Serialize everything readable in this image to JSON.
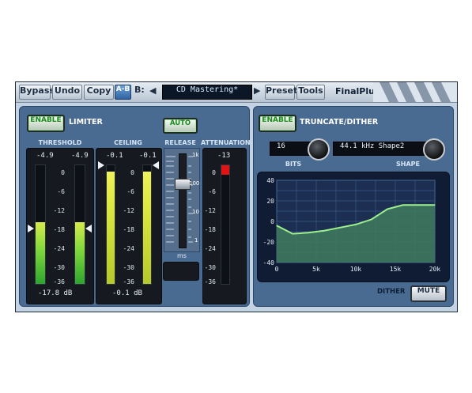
{
  "toolbar": {
    "bypass": "Bypass",
    "undo": "Undo",
    "copy": "Copy",
    "ab": "A-B",
    "b_label": "B:",
    "prev_arrow": "◀",
    "next_arrow": "▶",
    "preset_name": "CD Mastering*",
    "preset": "Preset",
    "tools": "Tools",
    "brand": "FinalPlug"
  },
  "limiter": {
    "enable_label": "ENABLE",
    "title": "LIMITER",
    "threshold": {
      "label": "THRESHOLD",
      "left_peak": "-4.9",
      "right_peak": "-4.9",
      "value": "-17.8 dB",
      "left_level": 0.52,
      "right_level": 0.52
    },
    "ceiling": {
      "label": "CEILING",
      "left_peak": "-0.1",
      "right_peak": "-0.1",
      "value": "-0.1 dB",
      "left_level": 0.95,
      "right_level": 0.95
    },
    "scale": [
      "0",
      "-6",
      "-12",
      "-18",
      "-24",
      "-30",
      "-36"
    ],
    "release": {
      "label": "RELEASE",
      "auto_label": "AUTO",
      "scale": [
        "1k",
        "100",
        "10",
        "1"
      ],
      "unit": "ms",
      "position": 0.3
    },
    "attenuation": {
      "label": "ATTENUATION",
      "peak": "-13",
      "scale": [
        "0",
        "-6",
        "-12",
        "-18",
        "-24",
        "-30",
        "-36"
      ],
      "level": 0.08
    }
  },
  "truncate": {
    "enable_label": "ENABLE",
    "title": "TRUNCATE/DITHER",
    "bits_value": "16",
    "bits_label": "BITS",
    "shape_value": "44.1 kHz Shape2",
    "shape_label": "SHAPE",
    "dither_label": "DITHER",
    "mute_label": "MUTE"
  },
  "chart_data": {
    "type": "area",
    "x": [
      0,
      2000,
      4000,
      6000,
      8000,
      10000,
      12000,
      14000,
      16000,
      18000,
      20000
    ],
    "y": [
      -4,
      -12,
      -11,
      -9,
      -6,
      -3,
      2,
      12,
      16,
      16,
      16
    ],
    "xlim": [
      0,
      20000
    ],
    "ylim": [
      -40,
      40
    ],
    "xticks": [
      "0",
      "5k",
      "10k",
      "15k",
      "20k"
    ],
    "yticks": [
      "40",
      "20",
      "0",
      "-20",
      "-40"
    ],
    "grid": true,
    "line_color": "#9ef08d",
    "fill_color": "#3f7a5e"
  },
  "colors": {
    "panel": "#496b92",
    "meter_green": "#2ea52e",
    "meter_yellow": "#dde840",
    "attenuation_red": "#e01414"
  }
}
